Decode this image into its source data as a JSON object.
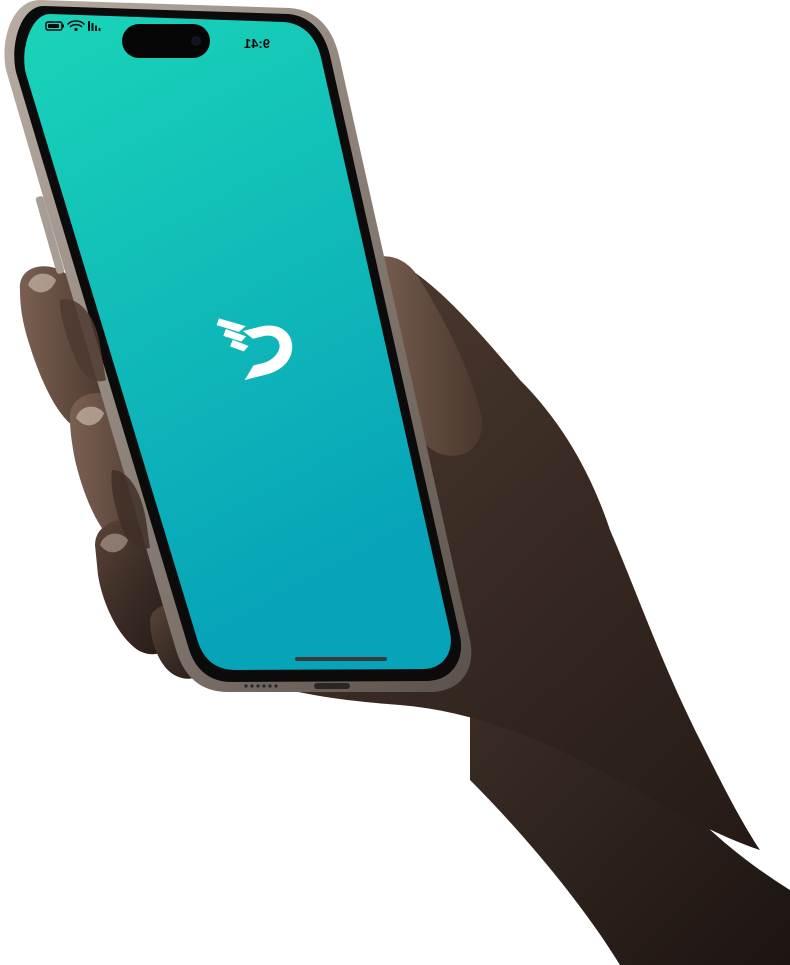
{
  "device": {
    "type": "smartphone",
    "frame_color": "#8a7f76",
    "screen_gradient_top": "#18d3b9",
    "screen_gradient_bottom": "#08a6b8"
  },
  "status_bar": {
    "time": "9:41",
    "icons": [
      "battery-icon",
      "wifi-icon",
      "cellular-signal-icon"
    ]
  },
  "app": {
    "screen": "splash",
    "logo": "app-logo-icon",
    "logo_color": "#ffffff"
  },
  "home_indicator": {
    "color": "#3a3a3a"
  }
}
